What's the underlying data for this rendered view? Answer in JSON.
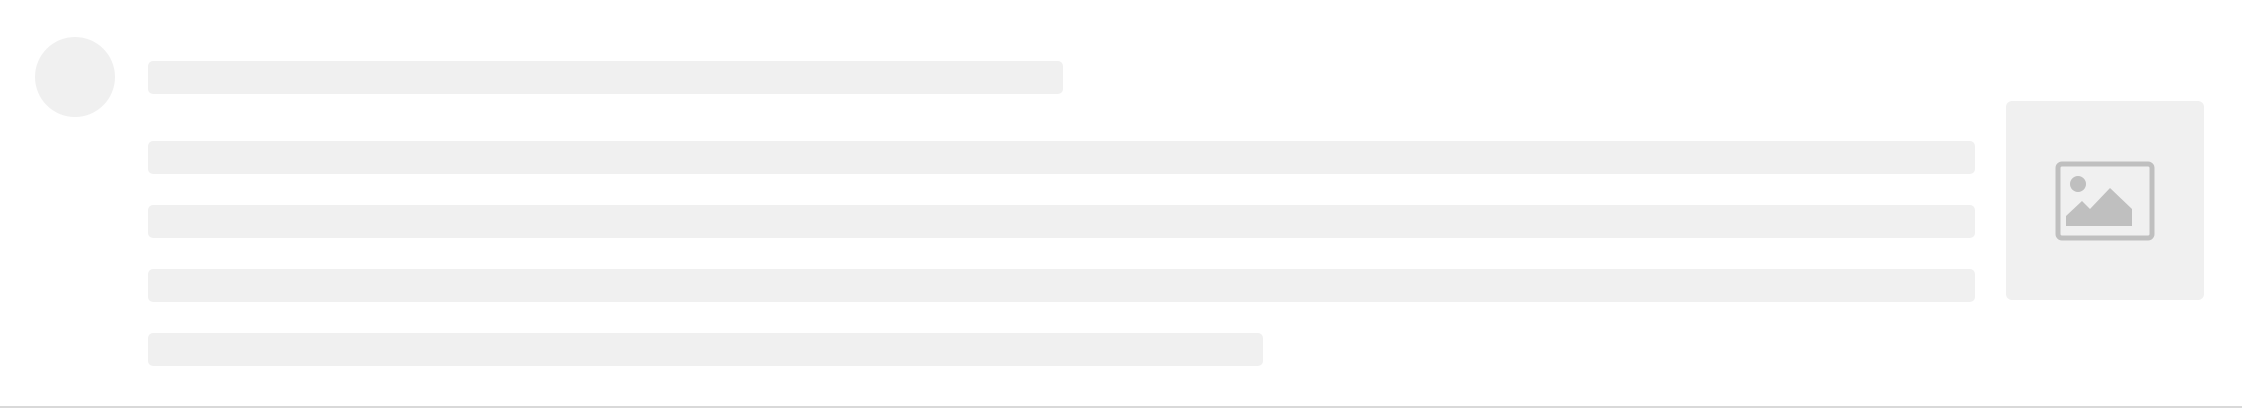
{
  "skeleton": {
    "avatar": {
      "icon": "avatar-placeholder"
    },
    "title_line": {
      "placeholder": true
    },
    "paragraph": {
      "lines": 4
    },
    "image": {
      "icon": "picture-icon"
    },
    "colors": {
      "block": "#f0f0f0",
      "icon": "#bfbfbf",
      "background": "#ffffff",
      "divider": "#d9d9d9"
    }
  }
}
